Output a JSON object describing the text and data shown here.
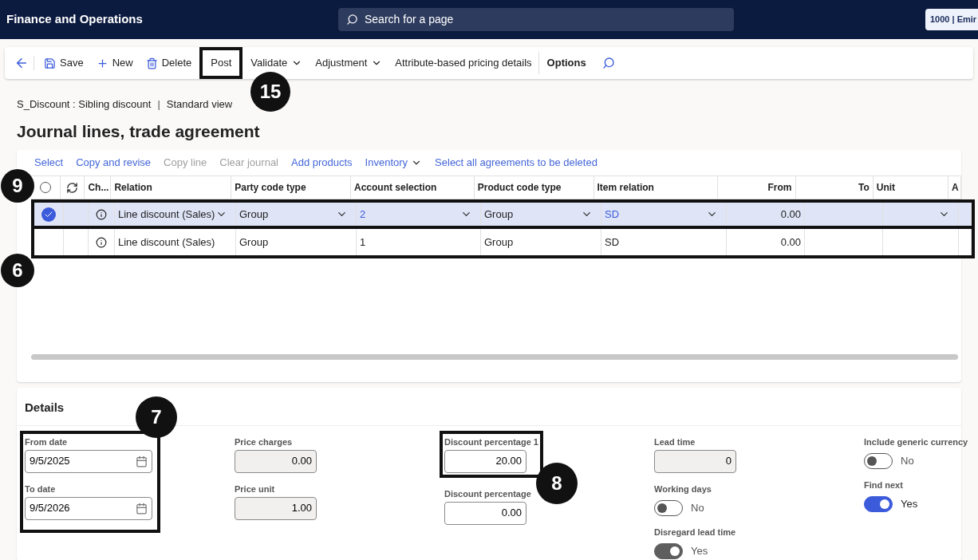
{
  "app_bar": {
    "title": "Finance and Operations",
    "search": {
      "placeholder": "Search for a page"
    },
    "company": "1000 | Emir"
  },
  "toolbar": [
    {
      "kind": "icon"
    },
    {
      "kind": "button",
      "label": "Save"
    },
    {
      "kind": "button",
      "label": "New"
    },
    {
      "kind": "button",
      "label": "Delete"
    },
    {
      "kind": "button",
      "label": "Post"
    },
    {
      "kind": "menu",
      "label": "Validate"
    },
    {
      "kind": "menu",
      "label": "Adjustment"
    },
    {
      "kind": "button",
      "label": "Attribute-based pricing details"
    },
    {
      "kind": "tab",
      "label": "Options"
    },
    {
      "kind": "icon"
    }
  ],
  "breadcrumb": {
    "record": "S_Discount : Sibling discount",
    "separator": "|",
    "view": "Standard view"
  },
  "page_title": "Journal lines, trade agreement",
  "grid_actions": [
    {
      "label": "Select",
      "disabled": false,
      "menu": false
    },
    {
      "label": "Copy and revise",
      "disabled": false,
      "menu": false
    },
    {
      "label": "Copy line",
      "disabled": true,
      "menu": false
    },
    {
      "label": "Clear journal",
      "disabled": true,
      "menu": false
    },
    {
      "label": "Add products",
      "disabled": false,
      "menu": false
    },
    {
      "label": "Inventory",
      "disabled": false,
      "menu": true
    },
    {
      "label": "Select all agreements to be deleted",
      "disabled": false,
      "menu": false
    }
  ],
  "grid": {
    "columns": [
      {
        "label": "Ch...",
        "kind": "info"
      },
      {
        "label": "Relation",
        "kind": "lookup"
      },
      {
        "label": "Party code type",
        "kind": "lookup"
      },
      {
        "label": "Account selection",
        "kind": "link"
      },
      {
        "label": "Product code type",
        "kind": "lookup"
      },
      {
        "label": "Item relation",
        "kind": "link"
      },
      {
        "label": "From",
        "kind": "number"
      },
      {
        "label": "To",
        "kind": "number"
      },
      {
        "label": "Unit",
        "kind": "lookup"
      },
      {
        "label": "A",
        "kind": "text"
      }
    ],
    "rows": [
      {
        "selected": true,
        "cells": [
          "",
          "Line discount (Sales)",
          "Group",
          "2",
          "Group",
          "SD",
          "0.00",
          "",
          "",
          ""
        ]
      },
      {
        "selected": false,
        "cells": [
          "",
          "Line discount (Sales)",
          "Group",
          "1",
          "Group",
          "SD",
          "0.00",
          "",
          "",
          ""
        ]
      }
    ]
  },
  "details": {
    "title": "Details",
    "columns": [
      [
        {
          "kind": "date",
          "label": "From date",
          "value": "9/5/2025"
        },
        {
          "kind": "date",
          "label": "To date",
          "value": "9/5/2026"
        }
      ],
      [
        {
          "kind": "number",
          "label": "Price charges",
          "value": "0.00",
          "disabled": true
        },
        {
          "kind": "number",
          "label": "Price unit",
          "value": "1.00",
          "disabled": true
        }
      ],
      [
        {
          "kind": "number",
          "label": "Discount percentage 1",
          "value": "20.00",
          "disabled": false
        },
        {
          "kind": "number",
          "label": "Discount percentage",
          "value": "0.00",
          "disabled": false
        }
      ],
      [
        {
          "kind": "number",
          "label": "Lead time",
          "value": "0",
          "disabled": true
        },
        {
          "kind": "toggle",
          "label": "Working days",
          "on": false,
          "disabled": false,
          "text": "No"
        },
        {
          "kind": "toggle",
          "label": "Disregard lead time",
          "on": true,
          "disabled": true,
          "text": "Yes"
        }
      ],
      [
        {
          "kind": "toggle",
          "label": "Include generic currency",
          "on": false,
          "disabled": false,
          "text": "No"
        },
        {
          "kind": "toggle",
          "label": "Find next",
          "on": true,
          "disabled": false,
          "text": "Yes"
        }
      ]
    ]
  },
  "callouts": [
    "15",
    "9",
    "6",
    "7",
    "8"
  ]
}
